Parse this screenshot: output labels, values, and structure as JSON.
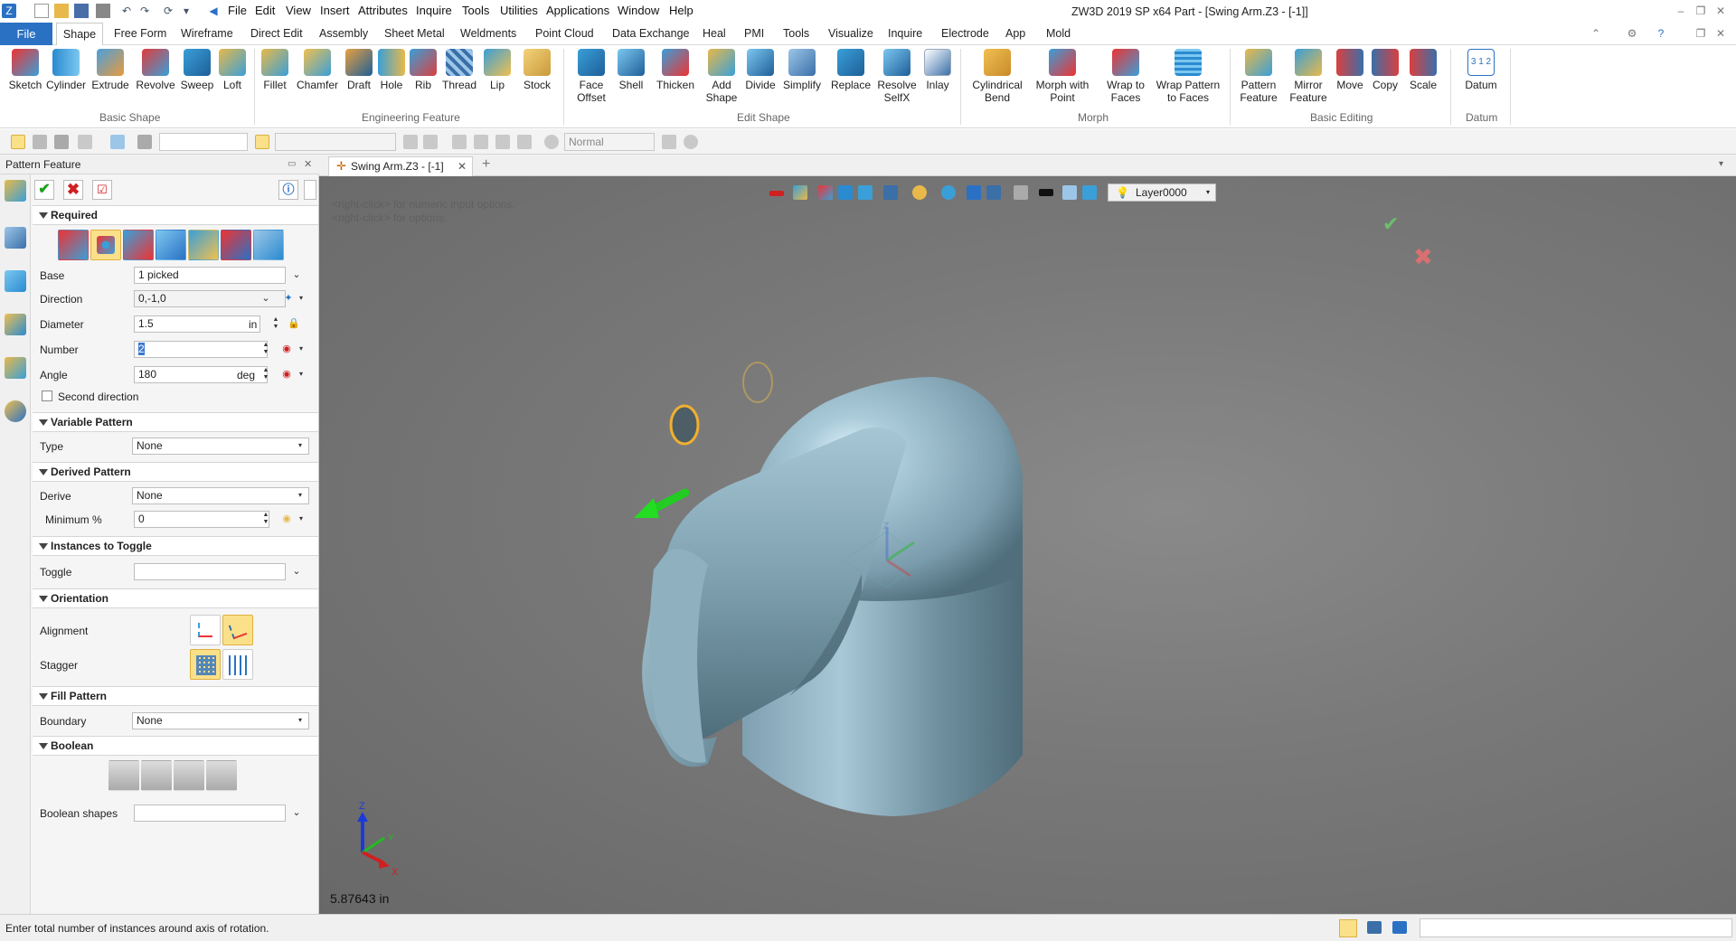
{
  "window": {
    "title": "ZW3D 2019 SP x64        Part - [Swing Arm.Z3 - [-1]]"
  },
  "menu": [
    "File",
    "Edit",
    "View",
    "Insert",
    "Attributes",
    "Inquire",
    "Tools",
    "Utilities",
    "Applications",
    "Window",
    "Help"
  ],
  "tabs": [
    "File",
    "Shape",
    "Free Form",
    "Wireframe",
    "Direct Edit",
    "Assembly",
    "Sheet Metal",
    "Weldments",
    "Point Cloud",
    "Data Exchange",
    "Heal",
    "PMI",
    "Tools",
    "Visualize",
    "Inquire",
    "Electrode",
    "App",
    "Mold"
  ],
  "ribbon": {
    "buttons": [
      "Sketch",
      "Cylinder",
      "Extrude",
      "Revolve",
      "Sweep",
      "Loft",
      "Fillet",
      "Chamfer",
      "Draft",
      "Hole",
      "Rib",
      "Thread",
      "Lip",
      "Stock",
      "Face\nOffset",
      "Shell",
      "Thicken",
      "Add\nShape",
      "Divide",
      "Simplify",
      "Replace",
      "Resolve\nSelfX",
      "Inlay",
      "Cylindrical\nBend",
      "Morph with\nPoint",
      "Wrap to\nFaces",
      "Wrap Pattern\nto Faces",
      "Pattern\nFeature",
      "Mirror\nFeature",
      "Move",
      "Copy",
      "Scale",
      "Datum"
    ],
    "groups": [
      "Basic Shape",
      "Engineering Feature",
      "Edit Shape",
      "Morph",
      "Basic Editing",
      "Datum"
    ]
  },
  "toolbar2": {
    "render_mode": "Normal"
  },
  "panel": {
    "title": "Pattern Feature",
    "sections": {
      "required": "Required",
      "variable": "Variable Pattern",
      "derived": "Derived Pattern",
      "toggle": "Instances to Toggle",
      "orientation": "Orientation",
      "fill": "Fill Pattern",
      "boolean": "Boolean"
    },
    "fields": {
      "base_label": "Base",
      "base_value": "1 picked",
      "direction_label": "Direction",
      "direction_value": "0,-1,0",
      "diameter_label": "Diameter",
      "diameter_value": "1.5",
      "diameter_unit": "in",
      "number_label": "Number",
      "number_value": "2",
      "angle_label": "Angle",
      "angle_value": "180",
      "angle_unit": "deg",
      "second_direction": "Second direction",
      "type_label": "Type",
      "type_value": "None",
      "derive_label": "Derive",
      "derive_value": "None",
      "minimum_label": "Minimum %",
      "minimum_value": "0",
      "toggle_label": "Toggle",
      "alignment_label": "Alignment",
      "stagger_label": "Stagger",
      "boundary_label": "Boundary",
      "boundary_value": "None",
      "boolean_shapes_label": "Boolean shapes"
    }
  },
  "document": {
    "tab": "Swing Arm.Z3 - [-1]",
    "layer": "Layer0000"
  },
  "viewport": {
    "hint1": "<right-click> for numeric input options.",
    "hint2": "<right-click> for options.",
    "measure": "5.87643 in",
    "axis_x": "X",
    "axis_y": "Y",
    "axis_z": "Z"
  },
  "status": {
    "prompt": "Enter total number of instances around axis of rotation."
  },
  "colors": {
    "accent": "#2a71c4",
    "selection": "#fbe08a",
    "model": "#8fb3c3"
  }
}
